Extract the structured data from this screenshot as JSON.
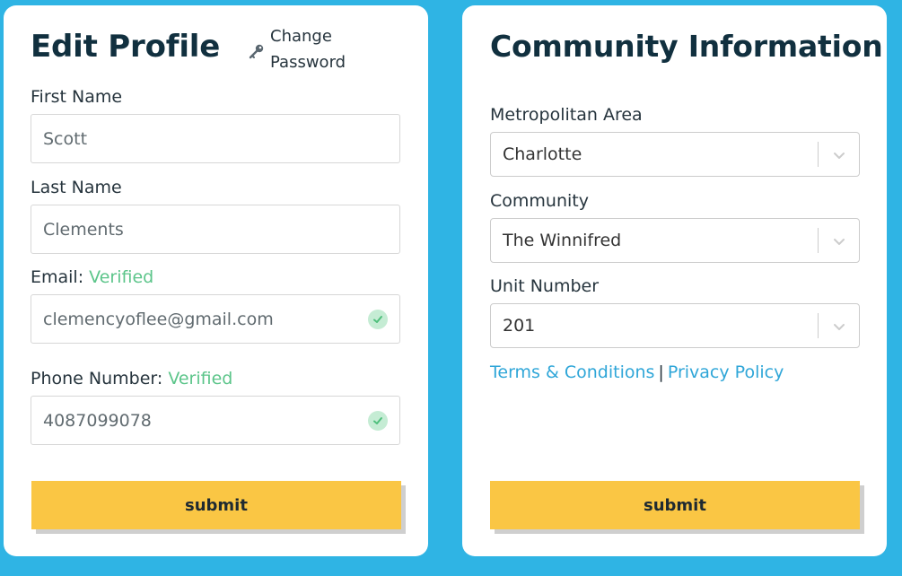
{
  "edit_profile": {
    "title": "Edit Profile",
    "change_password": "Change Password",
    "first_name": {
      "label": "First Name",
      "value": "Scott"
    },
    "last_name": {
      "label": "Last Name",
      "value": "Clements"
    },
    "email": {
      "label": "Email:",
      "status": "Verified",
      "value": "clemencyoflee@gmail.com"
    },
    "phone": {
      "label": "Phone Number:",
      "status": "Verified",
      "value": "4087099078"
    },
    "submit_label": "submit"
  },
  "community": {
    "title": "Community Information",
    "metro": {
      "label": "Metropolitan Area",
      "value": "Charlotte"
    },
    "community": {
      "label": "Community",
      "value": "The Winnifred"
    },
    "unit": {
      "label": "Unit Number",
      "value": "201"
    },
    "terms_label": "Terms & Conditions",
    "separator": "|",
    "privacy_label": "Privacy Policy",
    "submit_label": "submit"
  },
  "icons": {
    "key": "key-icon",
    "check": "check-circle-icon",
    "chevron": "chevron-down-icon"
  },
  "colors": {
    "background": "#2fb4e4",
    "accent": "#fac644",
    "verified": "#5cc58a",
    "link": "#2fa6d8",
    "heading": "#11303f"
  }
}
